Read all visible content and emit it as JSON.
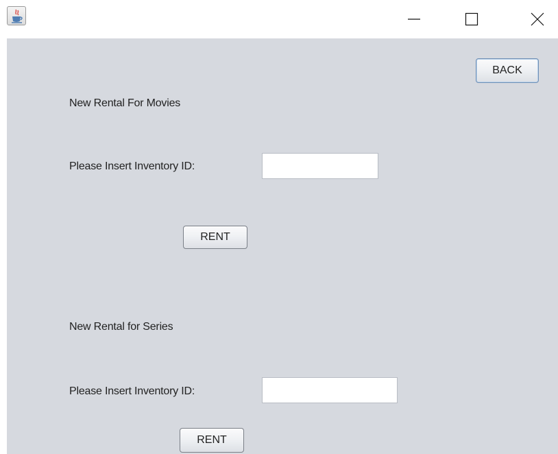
{
  "window": {
    "app_icon": "java-coffee-cup-icon",
    "controls": {
      "minimize": "minimize-icon",
      "maximize": "maximize-icon",
      "close": "close-icon"
    }
  },
  "header": {
    "back_label": "BACK"
  },
  "movies": {
    "title": "New Rental For Movies",
    "inventory_label": "Please Insert Inventory ID:",
    "inventory_value": "",
    "rent_label": "RENT"
  },
  "series": {
    "title": "New Rental for Series",
    "inventory_label": "Please Insert Inventory ID:",
    "inventory_value": "",
    "rent_label": "RENT"
  },
  "colors": {
    "panel_background": "#d6d9df",
    "titlebar_background": "#ffffff",
    "field_background": "#ffffff"
  }
}
